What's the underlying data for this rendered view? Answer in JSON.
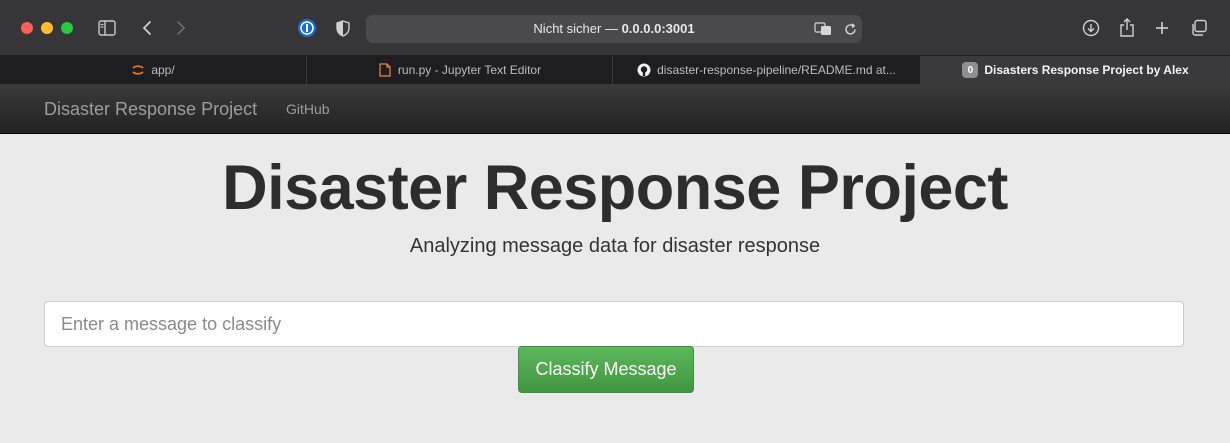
{
  "browser": {
    "address_prefix": "Nicht sicher — ",
    "address_host": "0.0.0.0:3001",
    "tabs": [
      {
        "label": "app/",
        "icon": "jupyter-icon"
      },
      {
        "label": "run.py - Jupyter Text Editor",
        "icon": "file-icon"
      },
      {
        "label": "disaster-response-pipeline/README.md at...",
        "icon": "github-icon"
      },
      {
        "label": "Disasters Response Project by Alex",
        "badge": "0"
      }
    ]
  },
  "nav": {
    "brand": "Disaster Response Project",
    "link": "GitHub"
  },
  "main": {
    "title": "Disaster Response Project",
    "subtitle": "Analyzing message data for disaster response",
    "input_placeholder": "Enter a message to classify",
    "button_label": "Classify Message"
  },
  "colors": {
    "button_green": "#5cb85c",
    "page_bg": "#eaeaea",
    "navbar_bg": "#222222"
  }
}
